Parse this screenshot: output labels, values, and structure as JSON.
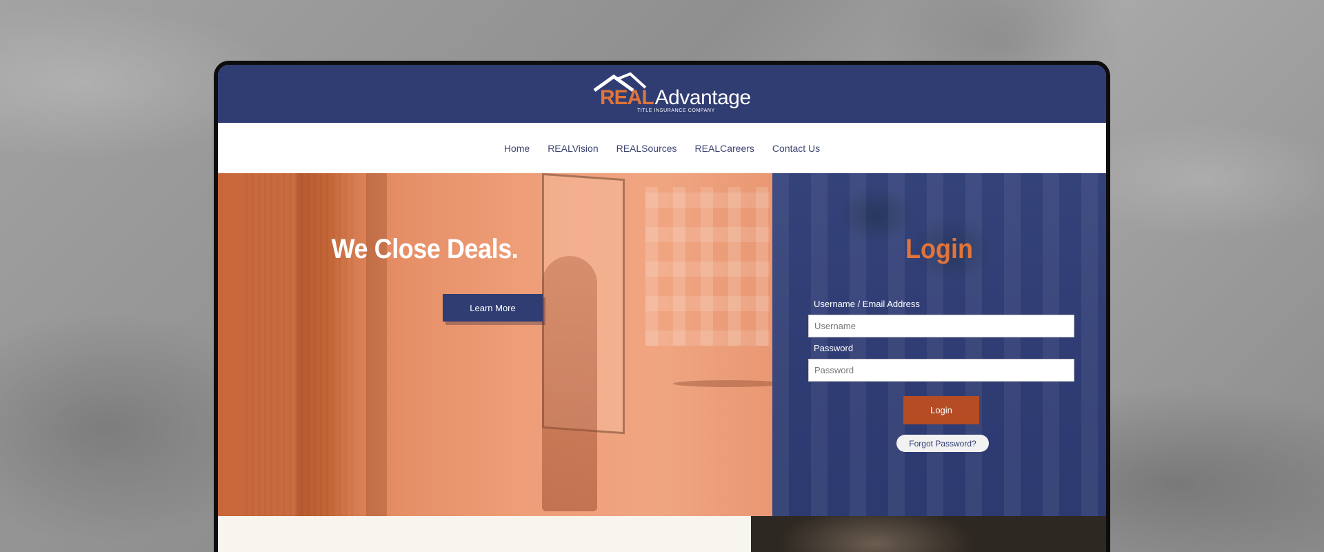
{
  "logo": {
    "brand_part1": "REAL",
    "brand_part2": "Advantage",
    "tagline": "TITLE INSURANCE COMPANY",
    "icon": "house-roof-icon"
  },
  "nav": {
    "items": [
      {
        "label": "Home"
      },
      {
        "label": "REALVision"
      },
      {
        "label": "REALSources"
      },
      {
        "label": "REALCareers"
      },
      {
        "label": "Contact Us"
      }
    ]
  },
  "hero": {
    "title": "We Close Deals.",
    "cta_label": "Learn More"
  },
  "login": {
    "title": "Login",
    "username_label": "Username / Email Address",
    "username_placeholder": "Username",
    "password_label": "Password",
    "password_placeholder": "Password",
    "submit_label": "Login",
    "forgot_label": "Forgot Password?"
  },
  "colors": {
    "navy": "#2f3d72",
    "orange": "#e2743a",
    "login_button": "#b54c24"
  }
}
